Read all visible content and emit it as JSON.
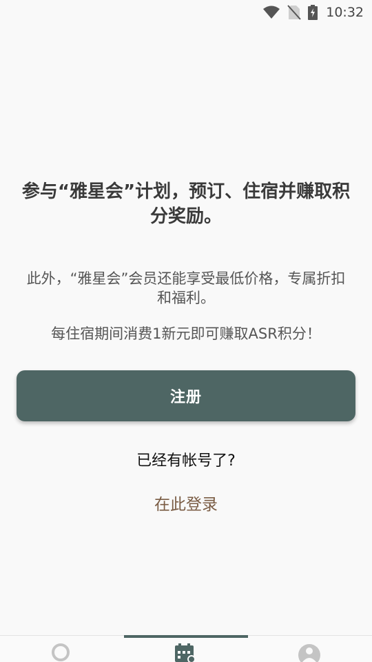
{
  "status_bar": {
    "time": "10:32",
    "icons": [
      "wifi-icon",
      "no-sim-icon",
      "battery-charging-icon"
    ]
  },
  "main": {
    "headline": "参与“雅星会”计划，预订、住宿并赚取积分奖励。",
    "benefits_text": "此外，“雅星会”会员还能享受最低价格，专属折扣和福利。",
    "earn_text": "每住宿期间消费1新元即可赚取ASR积分！",
    "register_label": "注册",
    "have_account_text": "已经有帐号了?",
    "login_label": "在此登录"
  },
  "bottom_nav": {
    "items": [
      {
        "icon": "search-icon",
        "active": false
      },
      {
        "icon": "calendar-icon",
        "active": true
      },
      {
        "icon": "profile-icon",
        "active": false
      }
    ]
  },
  "colors": {
    "accent": "#4e6664",
    "link": "#7a5c44",
    "background": "#f9f9f9"
  }
}
